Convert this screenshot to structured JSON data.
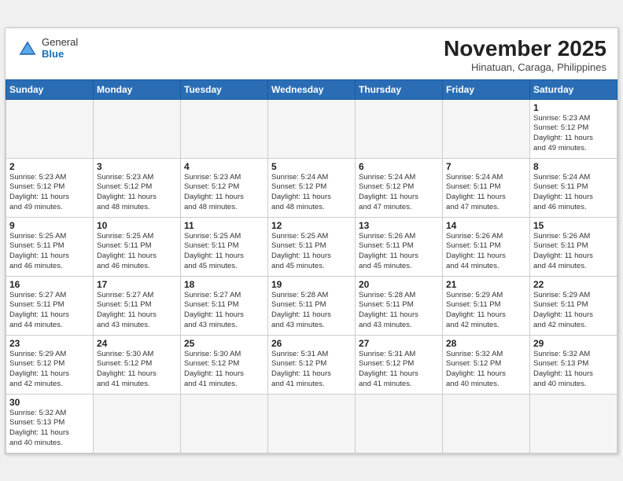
{
  "header": {
    "logo_general": "General",
    "logo_blue": "Blue",
    "month_year": "November 2025",
    "location": "Hinatuan, Caraga, Philippines"
  },
  "days_of_week": [
    "Sunday",
    "Monday",
    "Tuesday",
    "Wednesday",
    "Thursday",
    "Friday",
    "Saturday"
  ],
  "weeks": [
    [
      {
        "day": "",
        "info": ""
      },
      {
        "day": "",
        "info": ""
      },
      {
        "day": "",
        "info": ""
      },
      {
        "day": "",
        "info": ""
      },
      {
        "day": "",
        "info": ""
      },
      {
        "day": "",
        "info": ""
      },
      {
        "day": "1",
        "info": "Sunrise: 5:23 AM\nSunset: 5:12 PM\nDaylight: 11 hours\nand 49 minutes."
      }
    ],
    [
      {
        "day": "2",
        "info": "Sunrise: 5:23 AM\nSunset: 5:12 PM\nDaylight: 11 hours\nand 49 minutes."
      },
      {
        "day": "3",
        "info": "Sunrise: 5:23 AM\nSunset: 5:12 PM\nDaylight: 11 hours\nand 48 minutes."
      },
      {
        "day": "4",
        "info": "Sunrise: 5:23 AM\nSunset: 5:12 PM\nDaylight: 11 hours\nand 48 minutes."
      },
      {
        "day": "5",
        "info": "Sunrise: 5:24 AM\nSunset: 5:12 PM\nDaylight: 11 hours\nand 48 minutes."
      },
      {
        "day": "6",
        "info": "Sunrise: 5:24 AM\nSunset: 5:12 PM\nDaylight: 11 hours\nand 47 minutes."
      },
      {
        "day": "7",
        "info": "Sunrise: 5:24 AM\nSunset: 5:11 PM\nDaylight: 11 hours\nand 47 minutes."
      },
      {
        "day": "8",
        "info": "Sunrise: 5:24 AM\nSunset: 5:11 PM\nDaylight: 11 hours\nand 46 minutes."
      }
    ],
    [
      {
        "day": "9",
        "info": "Sunrise: 5:25 AM\nSunset: 5:11 PM\nDaylight: 11 hours\nand 46 minutes."
      },
      {
        "day": "10",
        "info": "Sunrise: 5:25 AM\nSunset: 5:11 PM\nDaylight: 11 hours\nand 46 minutes."
      },
      {
        "day": "11",
        "info": "Sunrise: 5:25 AM\nSunset: 5:11 PM\nDaylight: 11 hours\nand 45 minutes."
      },
      {
        "day": "12",
        "info": "Sunrise: 5:25 AM\nSunset: 5:11 PM\nDaylight: 11 hours\nand 45 minutes."
      },
      {
        "day": "13",
        "info": "Sunrise: 5:26 AM\nSunset: 5:11 PM\nDaylight: 11 hours\nand 45 minutes."
      },
      {
        "day": "14",
        "info": "Sunrise: 5:26 AM\nSunset: 5:11 PM\nDaylight: 11 hours\nand 44 minutes."
      },
      {
        "day": "15",
        "info": "Sunrise: 5:26 AM\nSunset: 5:11 PM\nDaylight: 11 hours\nand 44 minutes."
      }
    ],
    [
      {
        "day": "16",
        "info": "Sunrise: 5:27 AM\nSunset: 5:11 PM\nDaylight: 11 hours\nand 44 minutes."
      },
      {
        "day": "17",
        "info": "Sunrise: 5:27 AM\nSunset: 5:11 PM\nDaylight: 11 hours\nand 43 minutes."
      },
      {
        "day": "18",
        "info": "Sunrise: 5:27 AM\nSunset: 5:11 PM\nDaylight: 11 hours\nand 43 minutes."
      },
      {
        "day": "19",
        "info": "Sunrise: 5:28 AM\nSunset: 5:11 PM\nDaylight: 11 hours\nand 43 minutes."
      },
      {
        "day": "20",
        "info": "Sunrise: 5:28 AM\nSunset: 5:11 PM\nDaylight: 11 hours\nand 43 minutes."
      },
      {
        "day": "21",
        "info": "Sunrise: 5:29 AM\nSunset: 5:11 PM\nDaylight: 11 hours\nand 42 minutes."
      },
      {
        "day": "22",
        "info": "Sunrise: 5:29 AM\nSunset: 5:11 PM\nDaylight: 11 hours\nand 42 minutes."
      }
    ],
    [
      {
        "day": "23",
        "info": "Sunrise: 5:29 AM\nSunset: 5:12 PM\nDaylight: 11 hours\nand 42 minutes."
      },
      {
        "day": "24",
        "info": "Sunrise: 5:30 AM\nSunset: 5:12 PM\nDaylight: 11 hours\nand 41 minutes."
      },
      {
        "day": "25",
        "info": "Sunrise: 5:30 AM\nSunset: 5:12 PM\nDaylight: 11 hours\nand 41 minutes."
      },
      {
        "day": "26",
        "info": "Sunrise: 5:31 AM\nSunset: 5:12 PM\nDaylight: 11 hours\nand 41 minutes."
      },
      {
        "day": "27",
        "info": "Sunrise: 5:31 AM\nSunset: 5:12 PM\nDaylight: 11 hours\nand 41 minutes."
      },
      {
        "day": "28",
        "info": "Sunrise: 5:32 AM\nSunset: 5:12 PM\nDaylight: 11 hours\nand 40 minutes."
      },
      {
        "day": "29",
        "info": "Sunrise: 5:32 AM\nSunset: 5:13 PM\nDaylight: 11 hours\nand 40 minutes."
      }
    ],
    [
      {
        "day": "30",
        "info": "Sunrise: 5:32 AM\nSunset: 5:13 PM\nDaylight: 11 hours\nand 40 minutes."
      },
      {
        "day": "",
        "info": ""
      },
      {
        "day": "",
        "info": ""
      },
      {
        "day": "",
        "info": ""
      },
      {
        "day": "",
        "info": ""
      },
      {
        "day": "",
        "info": ""
      },
      {
        "day": "",
        "info": ""
      }
    ]
  ]
}
